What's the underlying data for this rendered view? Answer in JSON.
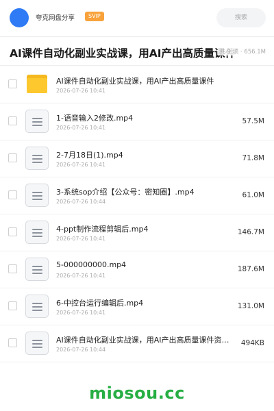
{
  "header": {
    "user_name": "夸克网盘分享",
    "badge": "SVIP",
    "search_placeholder": "搜索"
  },
  "folder": {
    "title": "AI课件自动化副业实战课，用AI产出高质量课件",
    "meta": "共 9 项 · 656.1M"
  },
  "files": [
    {
      "type": "folder",
      "icon": "folder-icon",
      "name": "AI课件自动化副业实战课，用AI产出高质量课件",
      "date": "2026-07-26 10:41",
      "size": ""
    },
    {
      "type": "file",
      "icon": "document-icon",
      "name": "1-语音输入2修改.mp4",
      "date": "2026-07-26 10:41",
      "size": "57.5M"
    },
    {
      "type": "file",
      "icon": "document-icon",
      "name": "2-7月18日(1).mp4",
      "date": "2026-07-26 10:41",
      "size": "71.8M"
    },
    {
      "type": "file",
      "icon": "document-icon",
      "name": "3-系统sop介绍【公众号：密知圈】.mp4",
      "date": "2026-07-26 10:44",
      "size": "61.0M"
    },
    {
      "type": "file",
      "icon": "document-icon",
      "name": "4-ppt制作流程剪辑后.mp4",
      "date": "2026-07-26 10:41",
      "size": "146.7M"
    },
    {
      "type": "file",
      "icon": "document-icon",
      "name": "5-000000000.mp4",
      "date": "2026-07-26 10:41",
      "size": "187.6M"
    },
    {
      "type": "file",
      "icon": "document-icon",
      "name": "6-中控台运行编辑后.mp4",
      "date": "2026-07-26 10:41",
      "size": "131.0M"
    },
    {
      "type": "file",
      "icon": "document-icon",
      "name": "AI课件自动化副业实战课，用AI产出高质量课件资料…",
      "date": "2026-07-26 10:44",
      "size": "494KB"
    }
  ],
  "watermark": "miosou.cc",
  "colors": {
    "avatar": "#2f7bf5",
    "badge": "#f7a23b",
    "folder": "#fcc82e",
    "watermark": "#27ae43"
  }
}
